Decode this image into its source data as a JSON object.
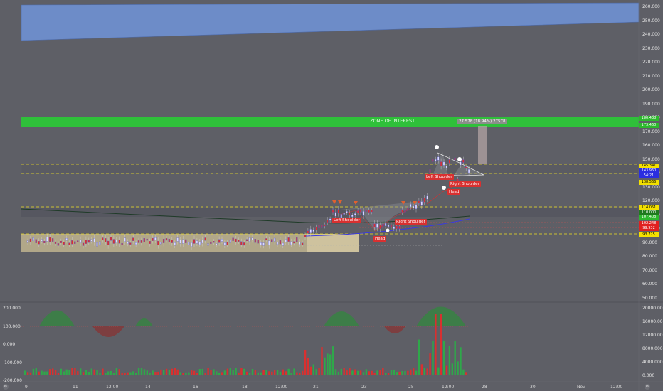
{
  "price_axis": {
    "ticks": [
      "260.000",
      "250.000",
      "240.000",
      "230.000",
      "220.000",
      "210.000",
      "200.000",
      "190.000",
      "180.000",
      "170.000",
      "160.000",
      "150.000",
      "140.000",
      "130.000",
      "120.000",
      "110.000",
      "100.000",
      "90.000",
      "80.000",
      "70.000",
      "60.000",
      "50.000"
    ],
    "badges": [
      {
        "label": "180.438",
        "bg": "#2db82d",
        "fg": "#ffffff"
      },
      {
        "label": "173.460",
        "bg": "#2db82d",
        "fg": "#ffffff"
      },
      {
        "label": "145.341",
        "bg": "#f3e000",
        "fg": "#000000"
      },
      {
        "label": "143.960",
        "bg": "#2a2ee0",
        "fg": "#ffffff"
      },
      {
        "label": "54:21",
        "bg": "#2a2ee0",
        "fg": "#ffffff"
      },
      {
        "label": "138.566",
        "bg": "#f3e000",
        "fg": "#000000"
      },
      {
        "label": "114.051",
        "bg": "#f3e000",
        "fg": "#000000"
      },
      {
        "label": "110.000",
        "bg": "#1f7a1f",
        "fg": "#ffffff"
      },
      {
        "label": "107.408",
        "bg": "#2db82d",
        "fg": "#ffffff"
      },
      {
        "label": "102.248",
        "bg": "#e02020",
        "fg": "#ffffff"
      },
      {
        "label": "99.932",
        "bg": "#e02020",
        "fg": "#ffffff"
      },
      {
        "label": "93.775",
        "bg": "#f3e000",
        "fg": "#000000"
      }
    ]
  },
  "volume_axis": {
    "ticks": [
      "20000.000",
      "16000.000",
      "12000.000",
      "8000.000",
      "4000.000",
      "0.000"
    ]
  },
  "oscillator_axis": {
    "ticks": [
      "200.000",
      "100.000",
      "0.000",
      "-100.000",
      "-200.000"
    ]
  },
  "time_axis": {
    "labels": [
      "9",
      "11",
      "12:00",
      "14",
      "16",
      "18",
      "12:00",
      "21",
      "23",
      "25",
      "12:00",
      "28",
      "30",
      "Nov",
      "12:00"
    ]
  },
  "annotations": {
    "zone_title": "ZONE OF INTEREST",
    "measure": "27.578 (18.94%) 27578",
    "patterns": [
      {
        "label": "Left Shoulder",
        "color": "#d93030"
      },
      {
        "label": "Head",
        "color": "#d93030"
      },
      {
        "label": "Right Shoulder",
        "color": "#d93030"
      },
      {
        "label": "Left Shoulder",
        "color": "#d93030"
      },
      {
        "label": "Head",
        "color": "#d93030"
      },
      {
        "label": "Right Shoulder",
        "color": "#d93030"
      }
    ]
  },
  "colors": {
    "background": "#5e5f66",
    "blue_zone": "#6d8cc8",
    "green_zone": "#2fc03a",
    "tan_zone": "#d9c89a",
    "bull": "#2fa84a",
    "bear": "#d93030",
    "dashed_level": "#f0e020"
  },
  "icons": {
    "corner_left": "settings-icon",
    "corner_right": "settings-icon"
  }
}
